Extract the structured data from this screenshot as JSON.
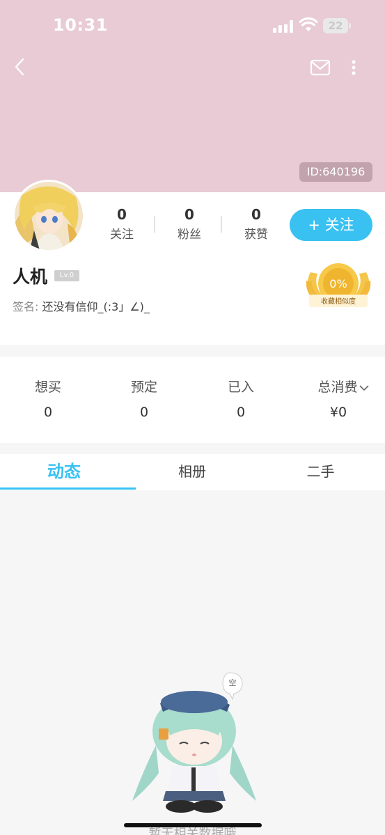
{
  "status_bar": {
    "time": "10:31",
    "battery": "22"
  },
  "header": {
    "id_label": "ID:640196",
    "icons": [
      "back-chevron-icon",
      "mail-icon",
      "more-vertical-icon"
    ]
  },
  "profile": {
    "stats": [
      {
        "value": "0",
        "label": "关注"
      },
      {
        "value": "0",
        "label": "粉丝"
      },
      {
        "value": "0",
        "label": "获赞"
      }
    ],
    "follow_button": "+ 关注",
    "username": "人机",
    "level": "Lv.0",
    "signature_label": "签名:",
    "signature": "还没有信仰_(:3」∠)_",
    "similarity": {
      "percent": "0%",
      "label": "收藏相似度"
    }
  },
  "consumption": [
    {
      "label": "想买",
      "value": "0"
    },
    {
      "label": "预定",
      "value": "0"
    },
    {
      "label": "已入",
      "value": "0"
    },
    {
      "label": "总消费",
      "value": "¥0"
    }
  ],
  "tabs": [
    {
      "label": "动态",
      "active": true
    },
    {
      "label": "相册",
      "active": false
    },
    {
      "label": "二手",
      "active": false
    }
  ],
  "empty_state": {
    "bubble": "空",
    "text": "暂无相关数据哦"
  },
  "colors": {
    "header_bg": "#e8cbd4",
    "accent": "#39c1f2",
    "medal": "#f5c64a"
  }
}
